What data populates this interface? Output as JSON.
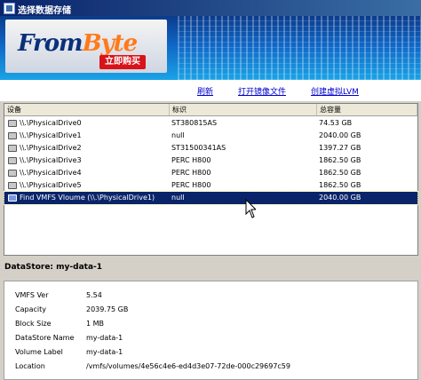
{
  "window": {
    "title": "选择数据存储"
  },
  "banner": {
    "logo_from": "From",
    "logo_byte": "Byte",
    "buy_label": "立即购买"
  },
  "toolbar": {
    "refresh": "刷新",
    "open_image": "打开镜像文件",
    "create_lvm": "创建虚拟LVM"
  },
  "table": {
    "headers": [
      "设备",
      "标识",
      "总容量"
    ],
    "rows": [
      {
        "device": "\\\\.\\PhysicalDrive0",
        "id": "ST380815AS",
        "size": "74.53 GB"
      },
      {
        "device": "\\\\.\\PhysicalDrive1",
        "id": "null",
        "size": "2040.00 GB"
      },
      {
        "device": "\\\\.\\PhysicalDrive2",
        "id": "ST31500341AS",
        "size": "1397.27 GB"
      },
      {
        "device": "\\\\.\\PhysicalDrive3",
        "id": "PERC H800",
        "size": "1862.50 GB"
      },
      {
        "device": "\\\\.\\PhysicalDrive4",
        "id": "PERC H800",
        "size": "1862.50 GB"
      },
      {
        "device": "\\\\.\\PhysicalDrive5",
        "id": "PERC H800",
        "size": "1862.50 GB"
      },
      {
        "device": "Find VMFS Vloume (\\\\.\\PhysicalDrive1)",
        "id": "null",
        "size": "2040.00 GB"
      }
    ]
  },
  "status": {
    "datastore": "DataStore: my-data-1"
  },
  "details": [
    {
      "label": "VMFS Ver",
      "value": "5.54"
    },
    {
      "label": "Capacity",
      "value": "2039.75 GB"
    },
    {
      "label": "Block Size",
      "value": "1 MB"
    },
    {
      "label": "DataStore Name",
      "value": "my-data-1"
    },
    {
      "label": "Volume Label",
      "value": "my-data-1"
    },
    {
      "label": "Location",
      "value": "/vmfs/volumes/4e56c4e6-ed4d3e07-72de-000c29697c59"
    }
  ]
}
